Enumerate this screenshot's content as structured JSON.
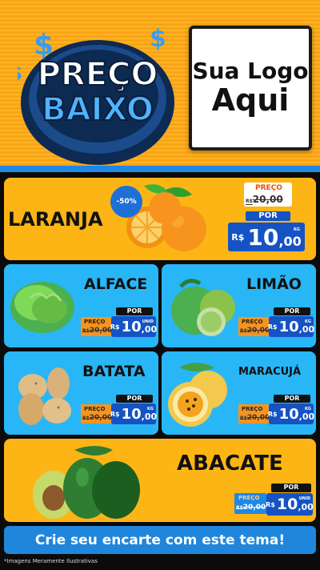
{
  "header": {
    "badge_line1": "PREÇO",
    "badge_line2": "BAIXO",
    "logo_line1": "Sua Logo",
    "logo_line2": "Aqui"
  },
  "products": {
    "laranja": {
      "name": "LARANJA",
      "discount": "-50%",
      "was_label": "PREÇO",
      "was_currency": "R$",
      "was_price": "20,00",
      "now_label": "POR",
      "currency": "R$",
      "price_int": "10",
      "price_dec": ",00",
      "unit": "KG"
    },
    "alface": {
      "name": "ALFACE",
      "was_label": "PREÇO",
      "was_currency": "R$",
      "was_price": "20,00",
      "now_label": "POR",
      "currency": "R$",
      "price_int": "10",
      "price_dec": ",00",
      "unit": "UNID"
    },
    "limao": {
      "name": "LIMÃO",
      "was_label": "PREÇO",
      "was_currency": "R$",
      "was_price": "20,00",
      "now_label": "POR",
      "currency": "R$",
      "price_int": "10",
      "price_dec": ",00",
      "unit": "KG"
    },
    "batata": {
      "name": "BATATA",
      "was_label": "PREÇO",
      "was_currency": "R$",
      "was_price": "20,00",
      "now_label": "POR",
      "currency": "R$",
      "price_int": "10",
      "price_dec": ",00",
      "unit": "KG"
    },
    "maracuja": {
      "name": "MARACUJÁ",
      "was_label": "PREÇO",
      "was_currency": "R$",
      "was_price": "20,00",
      "now_label": "POR",
      "currency": "R$",
      "price_int": "10",
      "price_dec": ",00",
      "unit": "KG"
    },
    "abacate": {
      "name": "ABACATE",
      "was_label": "PREÇO",
      "was_currency": "R$",
      "was_price": "20,00",
      "now_label": "POR",
      "currency": "R$",
      "price_int": "10",
      "price_dec": ",00",
      "unit": "UNID"
    }
  },
  "cta": "Crie seu encarte com este tema!",
  "disclaimer": "*Imagens Meramente Ilustrativas",
  "colors": {
    "orange": "#f7a51c",
    "yellow": "#fdb515",
    "blue": "#29b6f6",
    "price_blue": "#1553c4"
  }
}
